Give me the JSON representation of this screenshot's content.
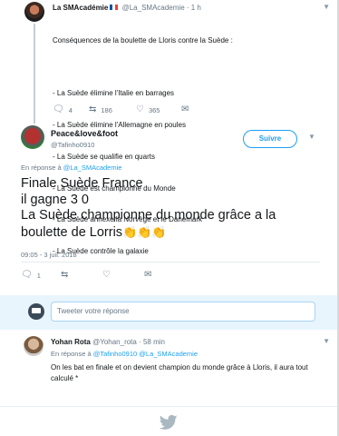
{
  "original_tweet": {
    "author_name": "La SMAcadémie",
    "meta": "@La_SMAcademie · 1 h",
    "body_lines": [
      "Conséquences de la boulette de Lloris contre la Suède :",
      "",
      "- La Suède élimine l'Italie en barrages",
      "- La Suède élimine l'Allemagne en poules",
      "- La Suède se qualifie en quarts",
      "- La Suède est championne du Monde",
      "- La Suède annexe la Norvège et le Danemark",
      "- La Suède contrôle la galaxie"
    ],
    "replies": "4",
    "retweets": "186",
    "likes": "365"
  },
  "main_tweet": {
    "author_name": "Peace&love&foot",
    "handle": "@Tafinho0910",
    "follow_label": "Suivre",
    "reply_prefix": "En réponse à ",
    "reply_to": "@La_SMAcademie",
    "text_lines": [
      "Finale Suède France",
      "il gagne 3 0",
      "La  Suède championne du monde grâce a la",
      "boulette de Lorris"
    ],
    "emoji": "👏👏👏",
    "timestamp": "09:05 - 3 juil. 2018",
    "replies": "1",
    "retweets": "",
    "likes": ""
  },
  "composer": {
    "placeholder": "Tweeter votre réponse"
  },
  "reply_tweet": {
    "author_name": "Yohan Rota",
    "meta": "@Yohan_rota · 58 min",
    "reply_prefix": "En réponse à ",
    "reply_to_1": "@Tafinho0910",
    "reply_and": " ",
    "reply_to_2": "@La_SMAcademie",
    "body": "On les bat en finale et on devient champion du monde grâce à Lloris, il aura tout calculé *"
  },
  "colors": {
    "accent": "#1da1f2",
    "retweet": "#657786",
    "like": "#657786"
  },
  "icons": [
    "reply-icon",
    "retweet-icon",
    "heart-icon",
    "mail-icon",
    "caret-down-icon",
    "twitter-bird-icon"
  ]
}
